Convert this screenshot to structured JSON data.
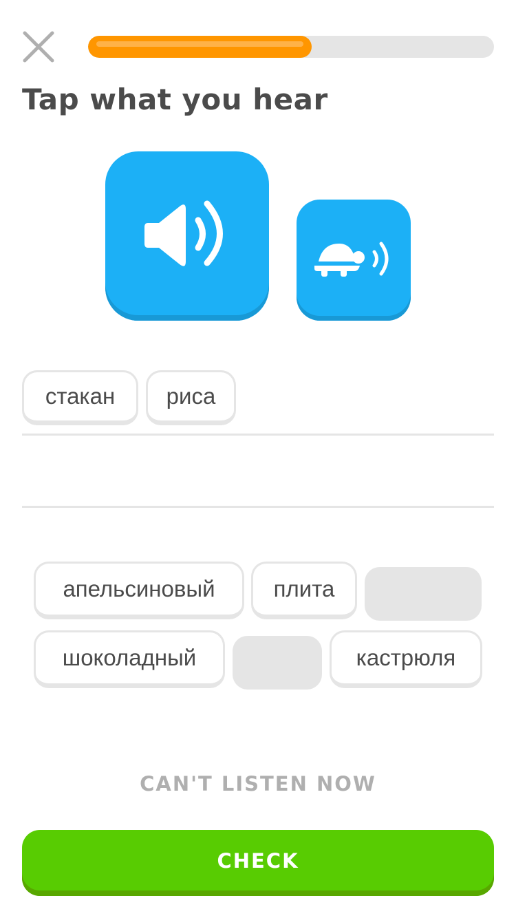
{
  "header": {
    "close_icon": "close-icon",
    "progress": 0.55
  },
  "title": "Tap what you hear",
  "audio": {
    "play_icon": "speaker-icon",
    "slow_icon": "turtle-speaker-icon"
  },
  "answer": {
    "words": [
      "стакан",
      "риса"
    ]
  },
  "word_bank": {
    "row1": [
      "апельсиновый",
      "плита"
    ],
    "row2": [
      "шоколадный",
      "кастрюля"
    ]
  },
  "cant_listen_label": "CAN'T LISTEN NOW",
  "check_label": "CHECK",
  "colors": {
    "accent_blue": "#1cb0f6",
    "progress_orange": "#ff9600",
    "check_green": "#58cc02"
  }
}
